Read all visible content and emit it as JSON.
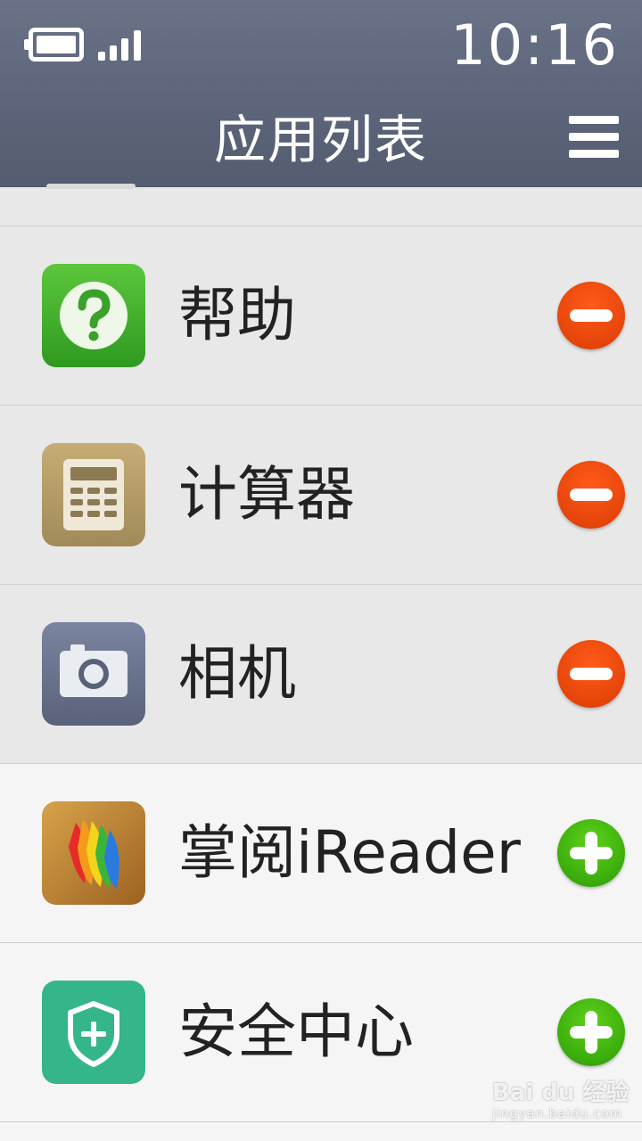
{
  "status_bar": {
    "time": "10:16",
    "battery_icon": "battery-icon",
    "signal_icon": "signal-icon"
  },
  "header": {
    "title": "应用列表",
    "menu_icon": "menu-icon"
  },
  "apps": [
    {
      "name": "帮助",
      "icon": "help-icon",
      "action": "remove"
    },
    {
      "name": "计算器",
      "icon": "calculator-icon",
      "action": "remove"
    },
    {
      "name": "相机",
      "icon": "camera-icon",
      "action": "remove"
    },
    {
      "name": "掌阅iReader",
      "icon": "ireader-icon",
      "action": "add"
    },
    {
      "name": "安全中心",
      "icon": "security-icon",
      "action": "add"
    }
  ],
  "watermark": {
    "text": "Bai du 经验",
    "url": "jingyan.baidu.com"
  },
  "colors": {
    "header": "#5c6479",
    "remove": "#e6450a",
    "add": "#3aac0c"
  }
}
